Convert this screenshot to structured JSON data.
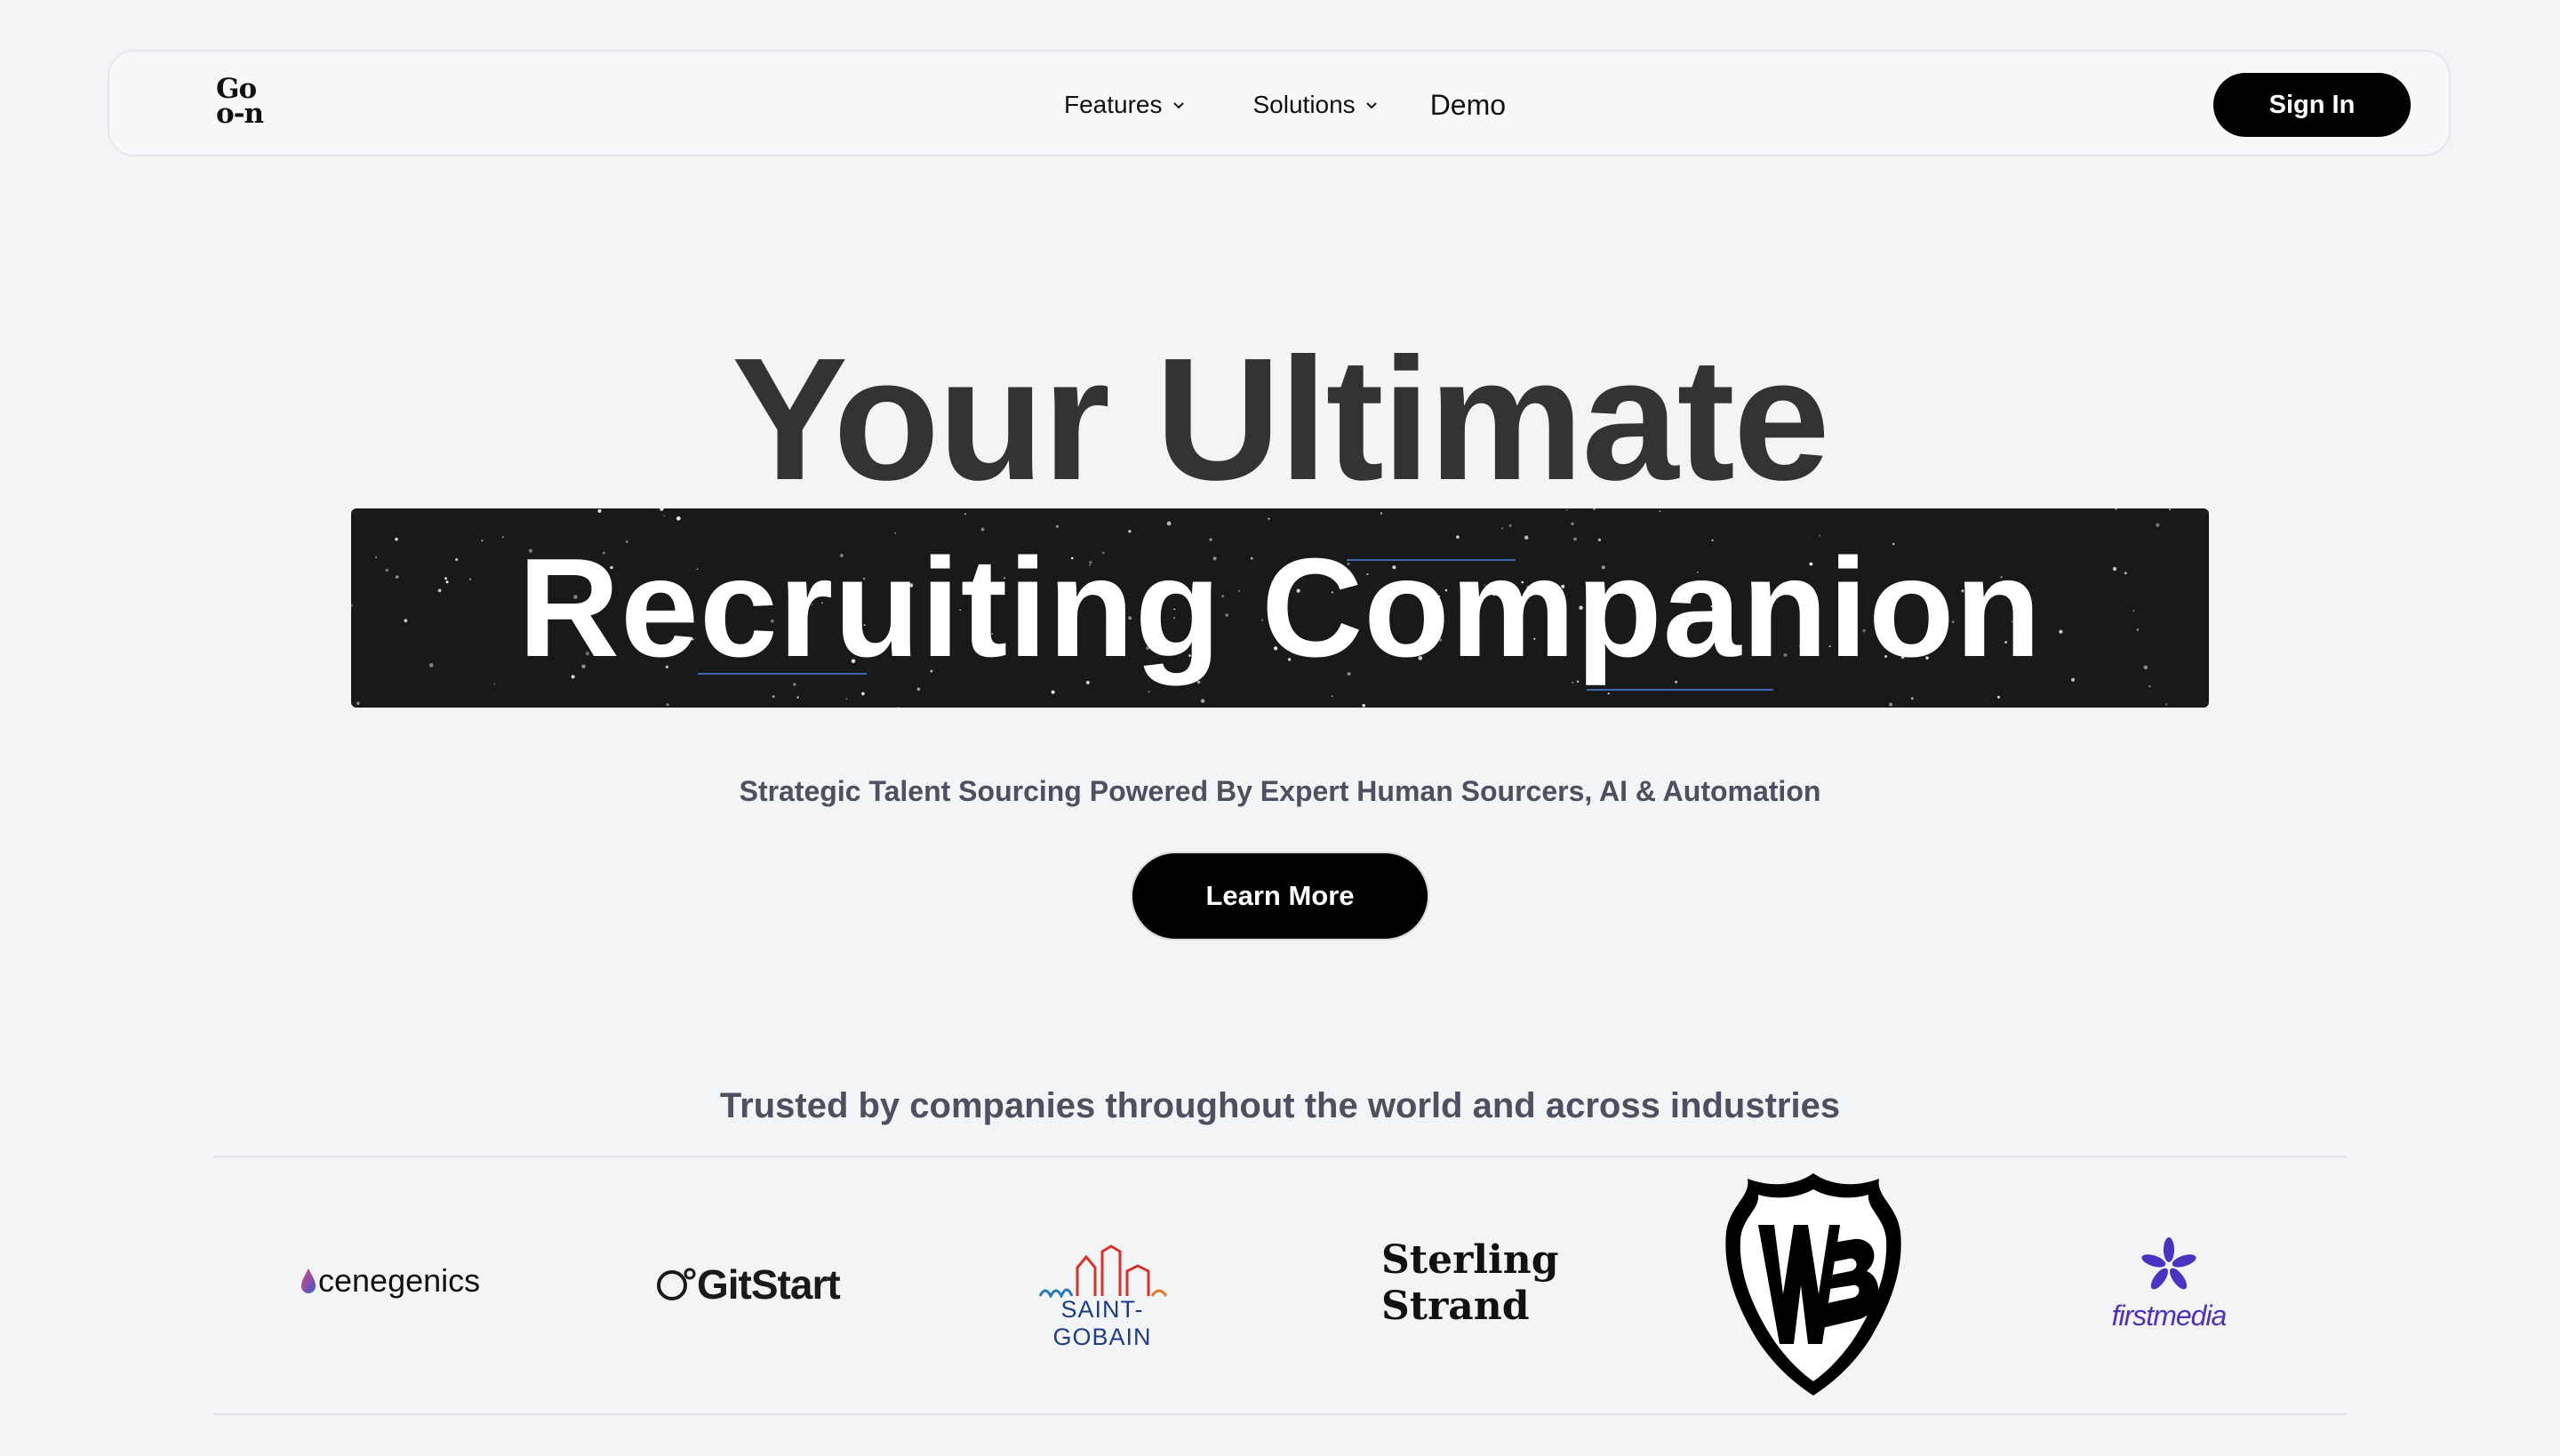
{
  "nav": {
    "logo_line1": "Go",
    "logo_line2": "o-n",
    "features_label": "Features",
    "solutions_label": "Solutions",
    "demo_label": "Demo",
    "signin_label": "Sign In"
  },
  "hero": {
    "line1": "Your Ultimate",
    "line2": "Recruiting Companion",
    "subtitle": "Strategic Talent Sourcing Powered By Expert Human Sourcers, AI & Automation",
    "cta_label": "Learn More"
  },
  "trusted": {
    "heading": "Trusted by companies throughout the world and across industries",
    "logos": [
      "cenegenics",
      "GitStart",
      "SAINT-GOBAIN",
      "Sterling",
      "Strand",
      "WB",
      "firstmedia"
    ]
  },
  "colors": {
    "background": "#f3f4f6",
    "banner": "#18191a",
    "button": "#000000",
    "subtext": "#4b5160",
    "firstmedia": "#4a33c3",
    "saint_gobain": "#1f3c8a"
  }
}
